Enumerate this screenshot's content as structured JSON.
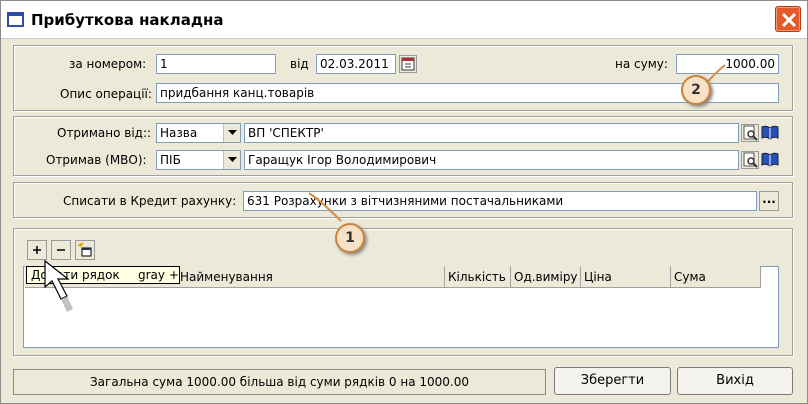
{
  "window": {
    "title": "Прибуткова накладна"
  },
  "header": {
    "number_label": "за номером:",
    "number_value": "1",
    "date_label": "від",
    "date_value": "02.03.2011",
    "sum_label": "на суму:",
    "sum_value": "1000.00",
    "description_label": "Опис операції:",
    "description_value": "придбання канц.товарів"
  },
  "parties": {
    "received_from_label": "Отримано від::",
    "received_from_type": "Назва",
    "received_from_value": "ВП 'СПЕКТР'",
    "received_by_label": "Отримав (МВО):",
    "received_by_type": "ПІБ",
    "received_by_value": "Гаращук Ігор Володимирович"
  },
  "credit": {
    "label": "Списати в Кредит рахунку:",
    "value": "631 Розрахунки з вітчизняними постачальниками",
    "browse_label": "..."
  },
  "table": {
    "columns": [
      "Найменування",
      "Кількість",
      "Од.виміру",
      "Ціна",
      "Сума"
    ],
    "rows": []
  },
  "tooltip": {
    "text": "Додати рядок",
    "shortcut": "gray +"
  },
  "callouts": [
    "1",
    "2"
  ],
  "footer": {
    "status": "Загальна сума 1000.00 більша від суми рядків 0 на 1000.00",
    "save_label": "Зберегти",
    "exit_label": "Вихід"
  }
}
